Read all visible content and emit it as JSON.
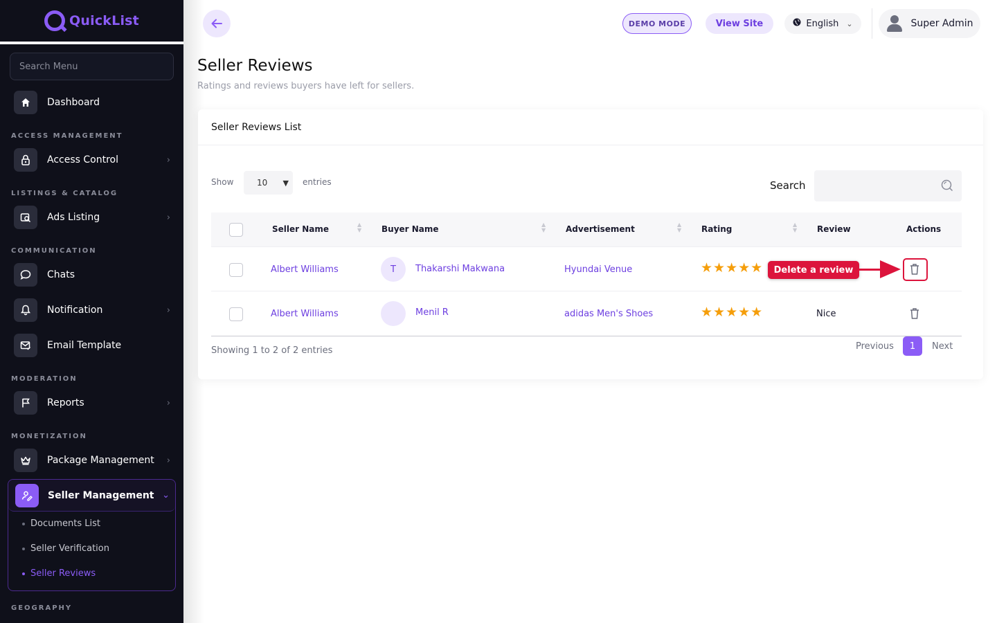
{
  "brand": {
    "name": "QuickList"
  },
  "sidebar": {
    "search_placeholder": "Search Menu",
    "dashboard": "Dashboard",
    "sections": {
      "access": "ACCESS MANAGEMENT",
      "listings": "LISTINGS & CATALOG",
      "communication": "COMMUNICATION",
      "moderation": "MODERATION",
      "monetization": "MONETIZATION",
      "geography": "GEOGRAPHY"
    },
    "items": {
      "access_control": "Access Control",
      "ads_listing": "Ads Listing",
      "chats": "Chats",
      "notification": "Notification",
      "email_template": "Email Template",
      "reports": "Reports",
      "package_management": "Package Management",
      "seller_management": "Seller Management"
    },
    "seller_sub": {
      "documents_list": "Documents List",
      "seller_verification": "Seller Verification",
      "seller_reviews": "Seller Reviews"
    }
  },
  "topbar": {
    "demo_mode": "DEMO MODE",
    "view_site": "View Site",
    "language": "English",
    "user": "Super Admin"
  },
  "page": {
    "title": "Seller Reviews",
    "subtitle": "Ratings and reviews buyers have left for sellers."
  },
  "card": {
    "title": "Seller Reviews List",
    "show_label": "Show",
    "entries_value": "10",
    "entries_label": "entries",
    "search_label": "Search"
  },
  "table": {
    "columns": {
      "seller": "Seller Name",
      "buyer": "Buyer Name",
      "ad": "Advertisement",
      "rating": "Rating",
      "review": "Review",
      "actions": "Actions"
    },
    "rows": [
      {
        "seller": "Albert Williams",
        "buyer_initial": "T",
        "buyer": "Thakarshi Makwana",
        "ad": "Hyundai Venue",
        "rating": 5,
        "review": ""
      },
      {
        "seller": "Albert Williams",
        "buyer_initial": "",
        "buyer": "Menil R",
        "ad": "adidas Men's Shoes",
        "rating": 5,
        "review": "Nice"
      }
    ],
    "showing": "Showing 1 to 2 of 2 entries",
    "previous": "Previous",
    "page": "1",
    "next": "Next"
  },
  "annotation": {
    "label": "Delete a review",
    "color": "#dc143c"
  },
  "colors": {
    "accent": "#8b5cf6",
    "star": "#f59e0b",
    "sidebar_bg": "#0f101a"
  }
}
